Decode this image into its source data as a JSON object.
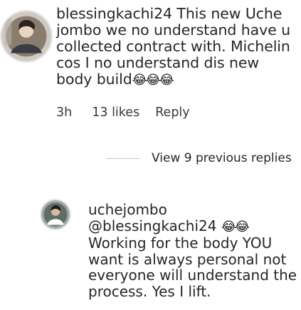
{
  "comment": {
    "username": "blessingkachi24",
    "text_before_emoji": " This new Uche jombo we no understand have u collected contract with. Michelin cos I no understand dis new body build",
    "emojis": "😂😂😂",
    "meta": {
      "time": "3h",
      "likes": "13 likes",
      "reply": "Reply"
    }
  },
  "replies": {
    "view_label": "View 9 previous replies"
  },
  "reply": {
    "username": "uchejombo",
    "mention": "@blessingkachi24",
    "emojis": "😂😂",
    "text": " Working for the body YOU want is always personal not everyone will understand the process. Yes I lift."
  },
  "colors": {
    "text": "#262626",
    "secondary": "#3a3a3a",
    "divider": "#c7c7c7"
  },
  "icons": {
    "avatar1": "profile-photo-avatar",
    "avatar2": "profile-photo-avatar"
  }
}
